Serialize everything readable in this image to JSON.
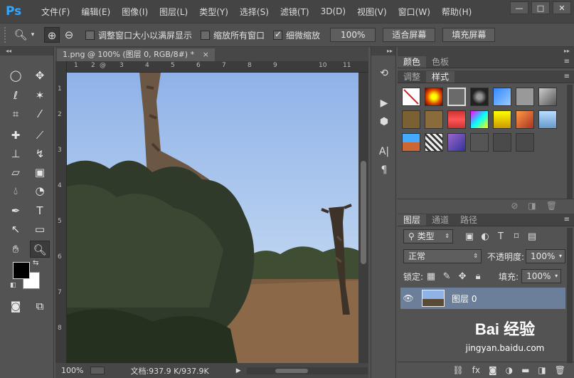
{
  "app": {
    "logo_text": "Ps"
  },
  "menu": [
    "文件(F)",
    "编辑(E)",
    "图像(I)",
    "图层(L)",
    "类型(Y)",
    "选择(S)",
    "滤镜(T)",
    "3D(D)",
    "视图(V)",
    "窗口(W)",
    "帮助(H)"
  ],
  "window_controls": {
    "minimize": "—",
    "maximize": "□",
    "close": "✕"
  },
  "options": {
    "resize_windows_label": "调整窗口大小以满屏显示",
    "resize_windows_checked": false,
    "zoom_all_label": "缩放所有窗口",
    "zoom_all_checked": false,
    "scrubby_label": "细微缩放",
    "scrubby_checked": true,
    "btn_100": "100%",
    "btn_fit": "适合屏幕",
    "btn_fill": "填充屏幕"
  },
  "document": {
    "tab_title": "1.png @ 100% (图层 0, RGB/8#) *",
    "close": "×",
    "ruler_h": [
      "1",
      "2",
      "@",
      "3",
      "4",
      "5",
      "6",
      "7",
      "8",
      "9",
      "10",
      "11"
    ],
    "ruler_v": [
      "1",
      "2",
      "3",
      "4",
      "5",
      "6",
      "7",
      "8"
    ]
  },
  "status": {
    "zoom": "100%",
    "doc_info": "文档:937.9 K/937.9K"
  },
  "color_panel": {
    "tabs": [
      "颜色",
      "色板"
    ]
  },
  "styles_panel": {
    "tabs": [
      "调整",
      "样式"
    ]
  },
  "layers_panel": {
    "tabs": [
      "图层",
      "通道",
      "路径"
    ],
    "filter_kind": "类型",
    "blend_mode": "正常",
    "opacity_label": "不透明度:",
    "opacity_value": "100%",
    "lock_label": "锁定:",
    "fill_label": "填充:",
    "fill_value": "100%",
    "layer_name": "图层 0"
  },
  "watermark": {
    "brand": "Bai 经验",
    "url": "jingyan.baidu.com"
  }
}
